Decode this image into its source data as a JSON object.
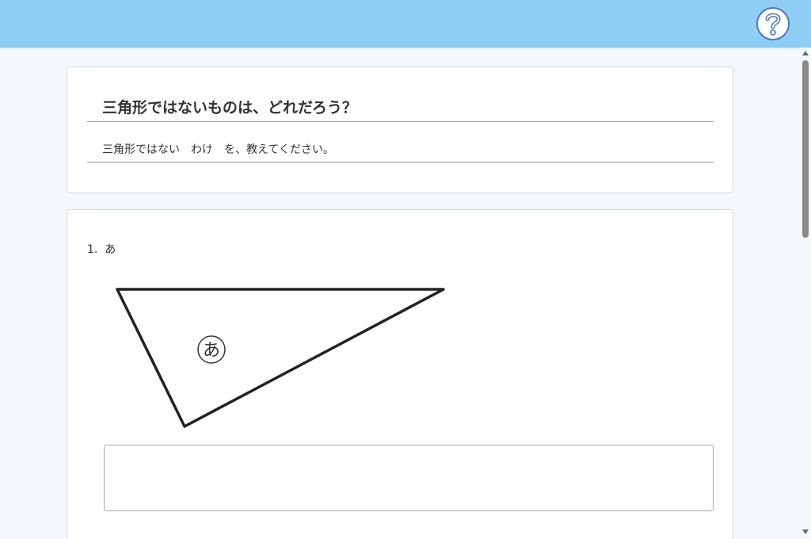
{
  "header": {
    "help_icon": "question-mark-icon",
    "bar_color": "#8fcdf5",
    "accent_color": "#4c78b8"
  },
  "form": {
    "title": "三角形ではないものは、どれだろう？",
    "description": "三角形ではない　わけ　を、教えてください。"
  },
  "questions": [
    {
      "number": "1.",
      "label": "あ",
      "figure_label": "あ",
      "answer_value": ""
    }
  ]
}
